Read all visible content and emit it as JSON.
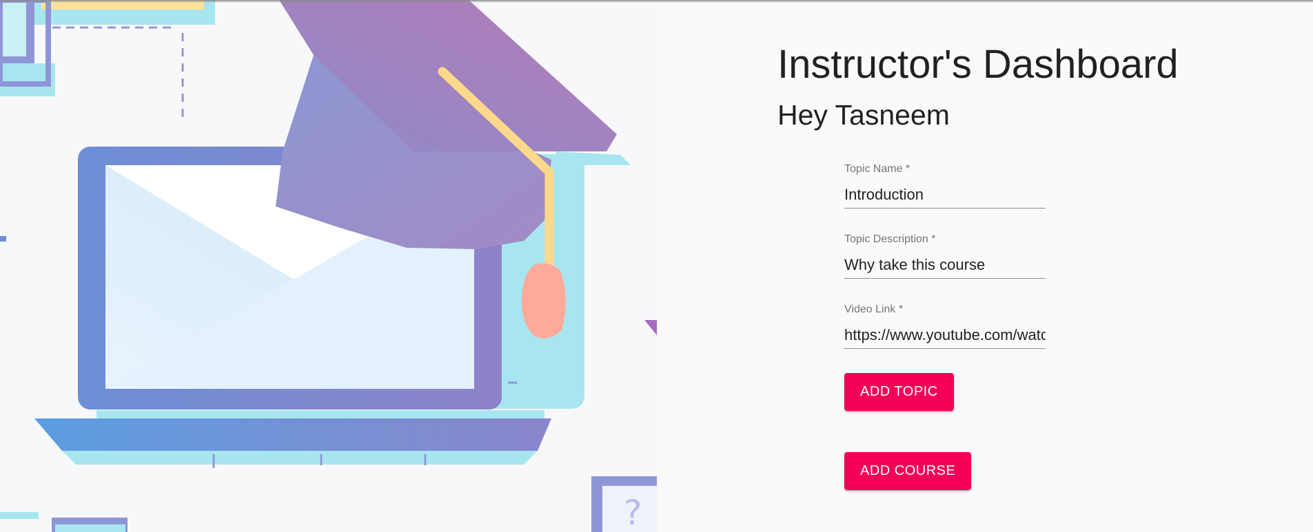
{
  "header": {
    "title": "Instructor's Dashboard",
    "greeting": "Hey Tasneem"
  },
  "form": {
    "topic_name": {
      "label": "Topic Name *",
      "value": "Introduction"
    },
    "topic_description": {
      "label": "Topic Description *",
      "value": "Why take this course"
    },
    "video_link": {
      "label": "Video Link *",
      "value": "https://www.youtube.com/watch"
    },
    "add_topic_label": "ADD TOPIC",
    "add_course_label": "ADD COURSE"
  },
  "illustration": {
    "icons": [
      "graduation-cap-icon",
      "laptop-icon",
      "question-mark-icon"
    ],
    "question_glyph": "?"
  },
  "colors": {
    "accent": "#f50057",
    "text": "#212121",
    "label": "#757575"
  }
}
